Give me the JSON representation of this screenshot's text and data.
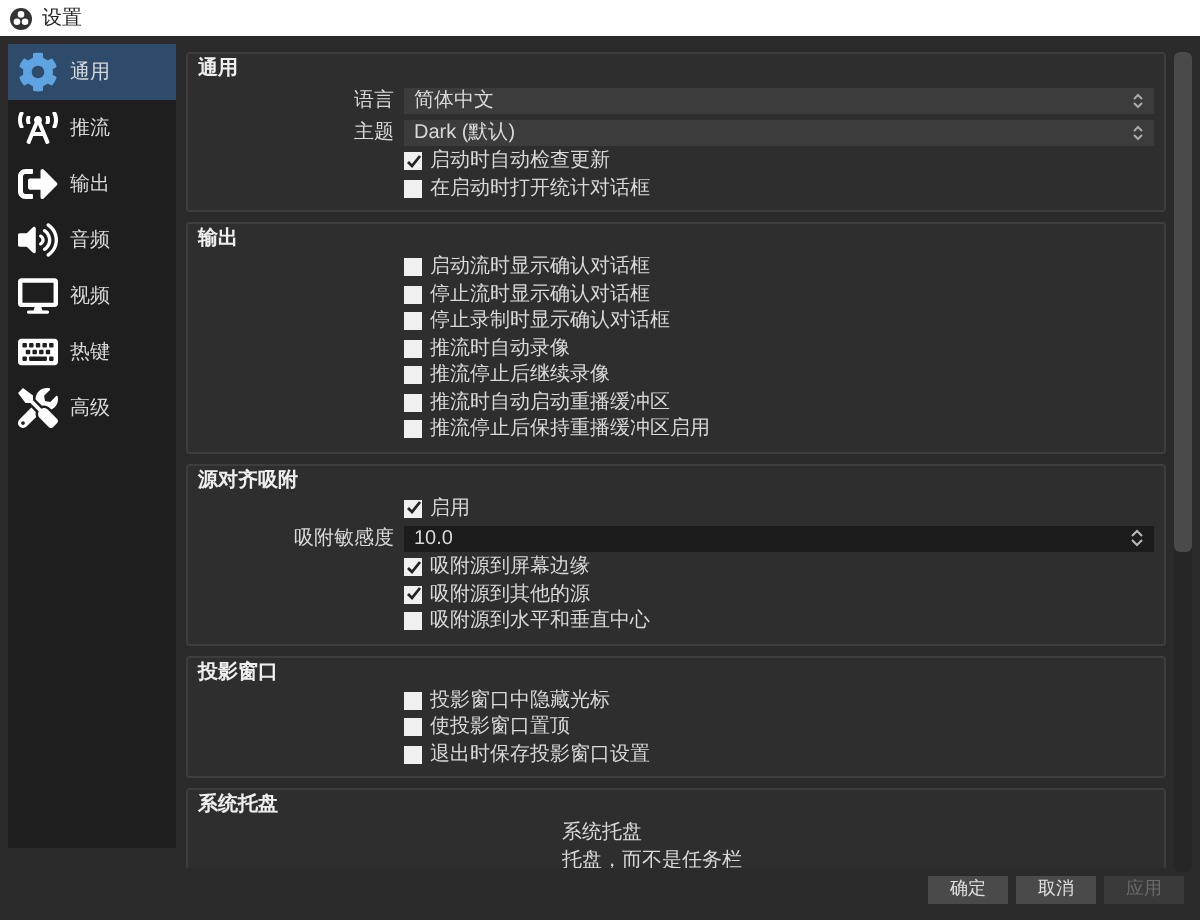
{
  "window": {
    "title": "设置"
  },
  "sidebar": {
    "items": [
      {
        "label": "通用",
        "selected": true
      },
      {
        "label": "推流",
        "selected": false
      },
      {
        "label": "输出",
        "selected": false
      },
      {
        "label": "音频",
        "selected": false
      },
      {
        "label": "视频",
        "selected": false
      },
      {
        "label": "热键",
        "selected": false
      },
      {
        "label": "高级",
        "selected": false
      }
    ]
  },
  "groups": [
    {
      "title": "通用",
      "rows": [
        {
          "kind": "select",
          "label": "语言",
          "value": "简体中文"
        },
        {
          "kind": "select",
          "label": "主题",
          "value": "Dark (默认)"
        },
        {
          "kind": "checkbox",
          "label": "启动时自动检查更新",
          "checked": true
        },
        {
          "kind": "checkbox",
          "label": "在启动时打开统计对话框",
          "checked": false
        }
      ]
    },
    {
      "title": "输出",
      "rows": [
        {
          "kind": "checkbox",
          "label": "启动流时显示确认对话框",
          "checked": false
        },
        {
          "kind": "checkbox",
          "label": "停止流时显示确认对话框",
          "checked": false
        },
        {
          "kind": "checkbox",
          "label": "停止录制时显示确认对话框",
          "checked": false
        },
        {
          "kind": "checkbox",
          "label": "推流时自动录像",
          "checked": false
        },
        {
          "kind": "checkbox",
          "label": "推流停止后继续录像",
          "checked": false
        },
        {
          "kind": "checkbox",
          "label": "推流时自动启动重播缓冲区",
          "checked": false
        },
        {
          "kind": "checkbox",
          "label": "推流停止后保持重播缓冲区启用",
          "checked": false
        }
      ]
    },
    {
      "title": "源对齐吸附",
      "rows": [
        {
          "kind": "checkbox",
          "label": "启用",
          "checked": true
        },
        {
          "kind": "spin",
          "label": "吸附敏感度",
          "value": "10.0"
        },
        {
          "kind": "checkbox",
          "label": "吸附源到屏幕边缘",
          "checked": true
        },
        {
          "kind": "checkbox",
          "label": "吸附源到其他的源",
          "checked": true
        },
        {
          "kind": "checkbox",
          "label": "吸附源到水平和垂直中心",
          "checked": false
        }
      ]
    },
    {
      "title": "投影窗口",
      "rows": [
        {
          "kind": "checkbox",
          "label": "投影窗口中隐藏光标",
          "checked": false
        },
        {
          "kind": "checkbox",
          "label": "使投影窗口置顶",
          "checked": false
        },
        {
          "kind": "checkbox",
          "label": "退出时保存投影窗口设置",
          "checked": false
        }
      ]
    },
    {
      "title": "系统托盘",
      "rows": [
        {
          "kind": "fragment",
          "label": "系统托盘"
        },
        {
          "kind": "fragment",
          "label": "托盘，而不是任务栏"
        }
      ]
    }
  ],
  "buttons": [
    {
      "label": "确定",
      "disabled": false
    },
    {
      "label": "取消",
      "disabled": false
    },
    {
      "label": "应用",
      "disabled": true
    }
  ]
}
